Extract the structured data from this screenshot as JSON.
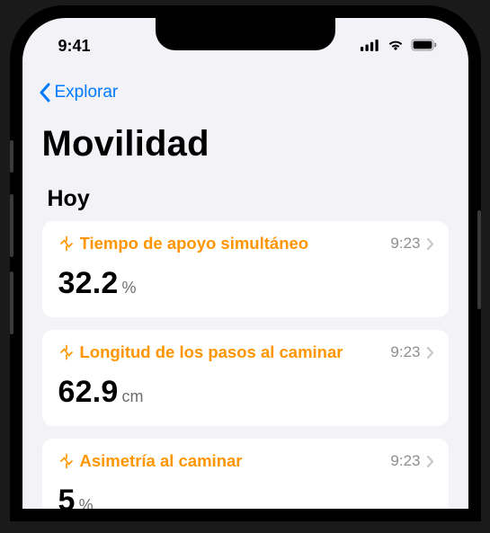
{
  "status": {
    "time": "9:41"
  },
  "nav": {
    "back_label": "Explorar"
  },
  "page": {
    "title": "Movilidad"
  },
  "section": {
    "title": "Hoy"
  },
  "colors": {
    "accent": "#ff9500",
    "link": "#007aff"
  },
  "metrics": [
    {
      "name": "Tiempo de apoyo simultáneo",
      "time": "9:23",
      "value": "32.2",
      "unit": "%"
    },
    {
      "name": "Longitud de los pasos al caminar",
      "time": "9:23",
      "value": "62.9",
      "unit": "cm"
    },
    {
      "name": "Asimetría al caminar",
      "time": "9:23",
      "value": "5",
      "unit": "%"
    }
  ]
}
